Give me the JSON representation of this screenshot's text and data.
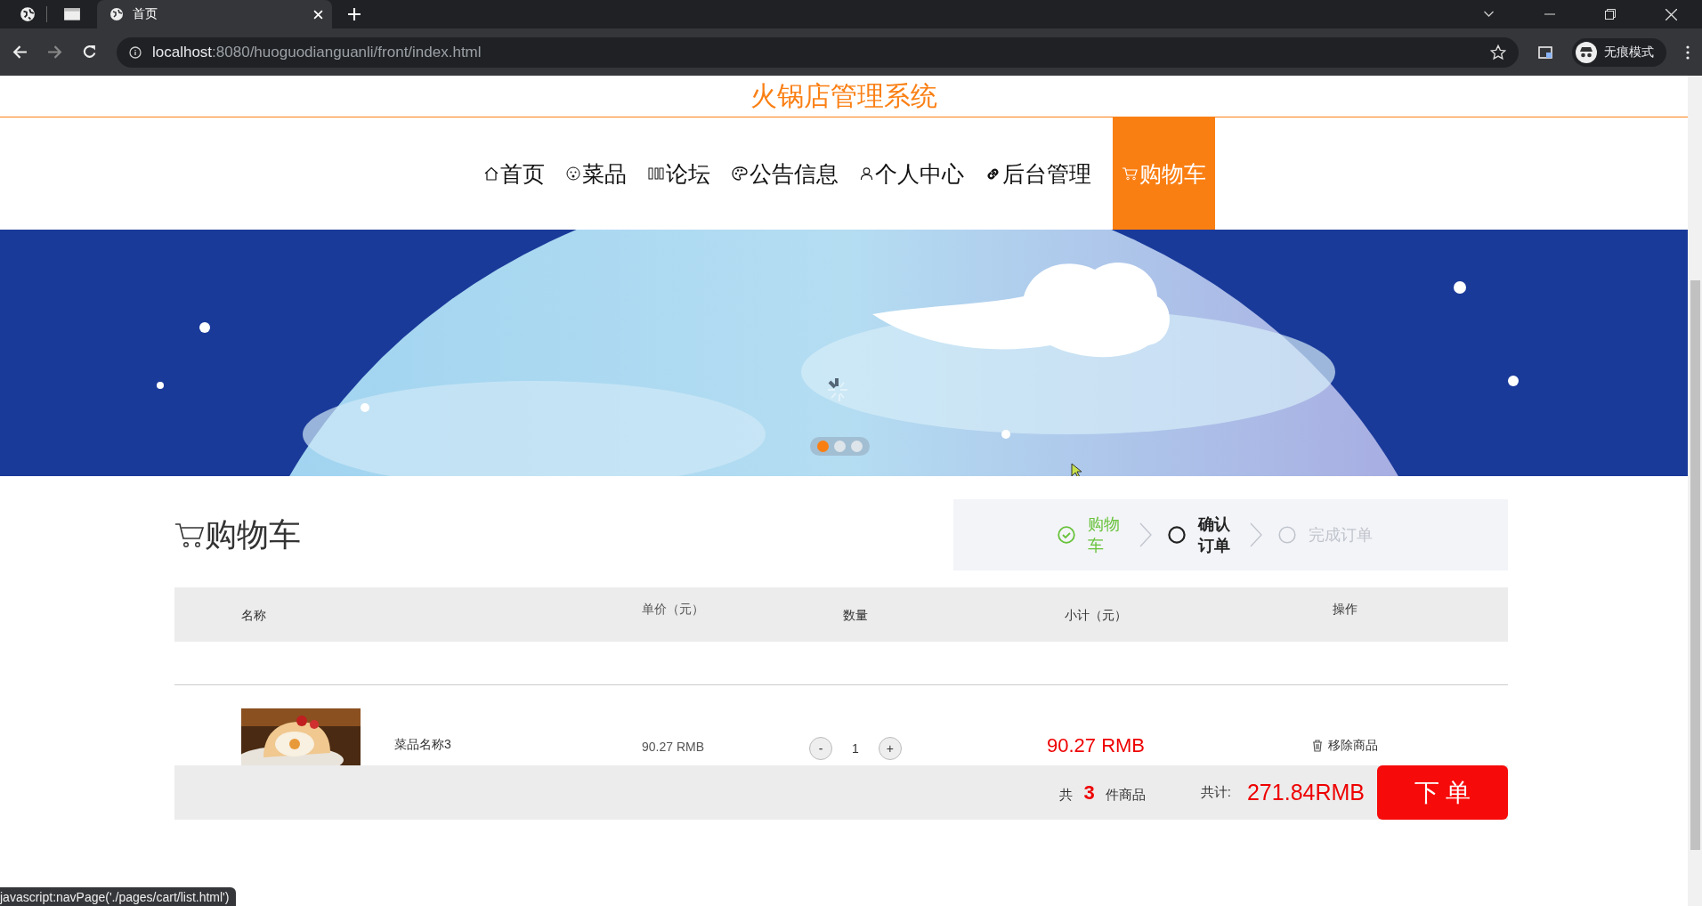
{
  "browser": {
    "tabs": [
      {
        "title": "首页",
        "selected": true
      }
    ],
    "url": {
      "host": "localhost",
      "rest": ":8080/huoguodianguanli/front/index.html"
    },
    "profile": "无痕模式"
  },
  "site": {
    "title": "火锅店管理系统"
  },
  "nav": [
    {
      "label": "首页",
      "selected": false
    },
    {
      "label": "菜品",
      "selected": false
    },
    {
      "label": "论坛",
      "selected": false
    },
    {
      "label": "公告信息",
      "selected": false
    },
    {
      "label": "个人中心",
      "selected": false
    },
    {
      "label": "后台管理",
      "selected": false
    },
    {
      "label": "购物车",
      "selected": true
    }
  ],
  "banner": {
    "dots": [
      {
        "selected": true
      },
      {
        "selected": false
      },
      {
        "selected": false
      }
    ]
  },
  "cart": {
    "heading": "购物车",
    "steps": [
      {
        "label": "购物车",
        "kind": "done"
      },
      {
        "label": "确认订单",
        "kind": "current"
      },
      {
        "label": "完成订单",
        "kind": "pending"
      }
    ],
    "columns": [
      "名称",
      "单价（元）",
      "数量",
      "小计（元）",
      "操作"
    ],
    "rows": [
      {
        "name": "菜品名称3",
        "price": "90.27 RMB",
        "minus": "-",
        "quantity": "1",
        "plus": "+",
        "subtotal": "90.27 RMB",
        "remove": "移除商品"
      }
    ],
    "summary": {
      "prefix": "共",
      "count": "3",
      "suffix": "件商品",
      "total_label": "共计:",
      "total": "271.84RMB",
      "order_button": "下 单"
    }
  },
  "status_bar": "javascript:navPage('./pages/cart/list.html')"
}
